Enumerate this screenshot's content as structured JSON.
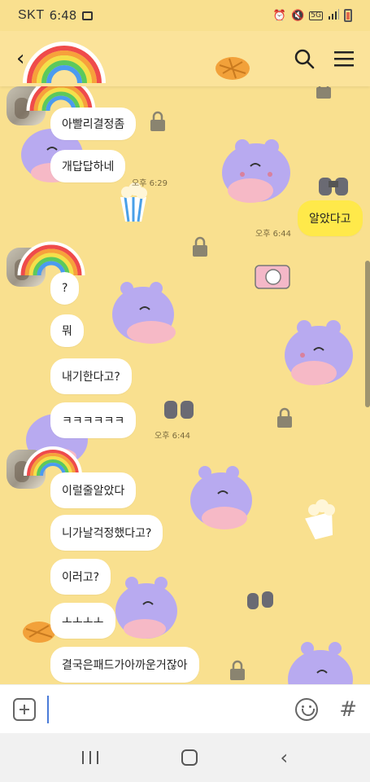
{
  "status_bar": {
    "carrier": "SKT",
    "time": "6:48",
    "network": "5G"
  },
  "header": {
    "back_glyph": "‹"
  },
  "messages": [
    {
      "id": "m1",
      "side": "in",
      "text": "아빨리결정좀"
    },
    {
      "id": "m2",
      "side": "in",
      "text": "개답답하네",
      "time": "오후 6:29"
    },
    {
      "id": "m3",
      "side": "out",
      "text": "알았다고",
      "time": "오후 6:44"
    },
    {
      "id": "m4",
      "side": "in",
      "text": "?"
    },
    {
      "id": "m5",
      "side": "in",
      "text": "뭐"
    },
    {
      "id": "m6",
      "side": "in",
      "text": "내기한다고?"
    },
    {
      "id": "m7",
      "side": "in",
      "text": "ㅋㅋㅋㅋㅋㅋ",
      "time": "오후 6:44"
    },
    {
      "id": "m8",
      "side": "in",
      "text": "이럴줄알았다"
    },
    {
      "id": "m9",
      "side": "in",
      "text": "니가날걱정했다고?"
    },
    {
      "id": "m10",
      "side": "in",
      "text": "이러고?"
    },
    {
      "id": "m11",
      "side": "in",
      "text": "ㅗㅗㅗㅗ"
    },
    {
      "id": "m12",
      "side": "in",
      "text": "결국은패드가아까운거잖아"
    }
  ],
  "input": {
    "placeholder": ""
  },
  "colors": {
    "background": "#f9e08f",
    "my_bubble": "#ffe94a",
    "their_bubble": "#ffffff"
  },
  "icons": [
    "search-icon",
    "menu-icon",
    "plus-icon",
    "emoji-icon",
    "hash-icon",
    "back-arrow-icon"
  ]
}
